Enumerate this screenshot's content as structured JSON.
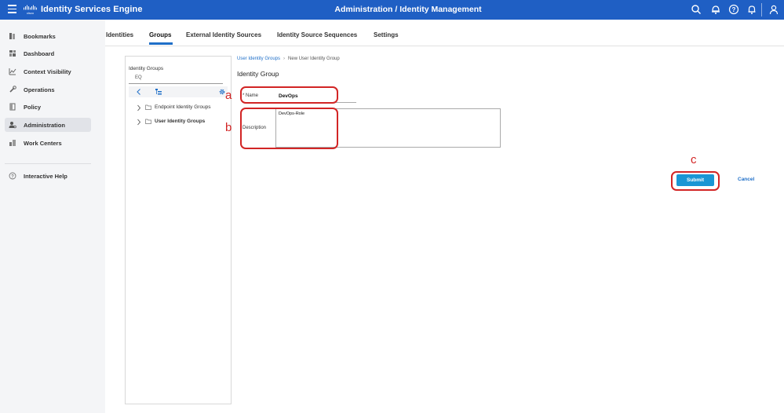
{
  "topbar": {
    "app_title": "Identity Services Engine",
    "page_heading": "Administration / Identity Management"
  },
  "sidebar": {
    "items": [
      {
        "label": "Bookmarks",
        "icon": "bookmark-icon"
      },
      {
        "label": "Dashboard",
        "icon": "dashboard-icon"
      },
      {
        "label": "Context Visibility",
        "icon": "context-visibility-icon"
      },
      {
        "label": "Operations",
        "icon": "operations-icon"
      },
      {
        "label": "Policy",
        "icon": "policy-icon"
      },
      {
        "label": "Administration",
        "icon": "administration-icon",
        "active": true
      },
      {
        "label": "Work Centers",
        "icon": "work-centers-icon"
      }
    ],
    "help": {
      "label": "Interactive Help",
      "icon": "help-circle-icon"
    }
  },
  "tabs": [
    {
      "label": "Identities"
    },
    {
      "label": "Groups",
      "active": true
    },
    {
      "label": "External Identity Sources"
    },
    {
      "label": "Identity Source Sequences"
    },
    {
      "label": "Settings"
    }
  ],
  "tree": {
    "title": "Identity Groups",
    "search_value": "EQ",
    "items": [
      {
        "label": "Endpoint Identity Groups"
      },
      {
        "label": "User Identity Groups",
        "bold": true
      }
    ]
  },
  "breadcrumb": {
    "parent": "User Identity Groups",
    "current": "New User Identity Group"
  },
  "form": {
    "title": "Identity Group",
    "name_label": "* Name",
    "name_value": "DevOps",
    "description_label": "Description",
    "description_value": "DevOps-Role",
    "submit_label": "Submit",
    "cancel_label": "Cancel"
  },
  "annotations": {
    "a": "a",
    "b": "b",
    "c": "c",
    "color": "#d22525"
  },
  "colors": {
    "topbar": "#1f5fc4",
    "primary_button": "#1a96d4",
    "link": "#1f6fc8"
  }
}
